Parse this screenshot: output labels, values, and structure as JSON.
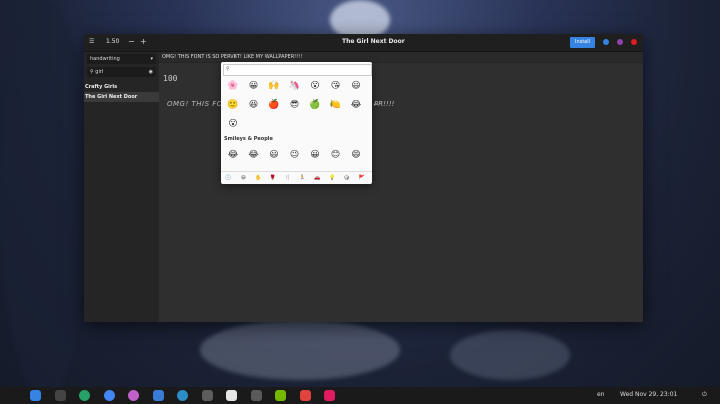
{
  "toolbar": {
    "menu_icon": "hamburger-icon",
    "font_size": "1.50",
    "decrease_label": "−",
    "increase_label": "+",
    "window_title": "The Girl Next Door",
    "install_label": "Install",
    "install_color": "#3584e4",
    "dot_colors": [
      "#3584e4",
      "#9141ac",
      "#e01b24"
    ]
  },
  "sidebar": {
    "category_value": "handwriting",
    "search_value": "girl",
    "items": [
      {
        "label": "Crafty Girls"
      },
      {
        "label": "The Girl Next Door"
      }
    ]
  },
  "preview": {
    "input_value": "OMG! THIS FONT IS SO PERVE̶T! LIKE MY WALLPAPER!!!!",
    "size_label": "100",
    "rendered_text": "OMG! THIS FON",
    "rendered_tail": "P̶R!!!!"
  },
  "emoji_picker": {
    "recent": [
      "🌸",
      "😀",
      "🙌",
      "🦄",
      "😮",
      "😘",
      "😃",
      "🙂",
      "😆",
      "🍎",
      "😎",
      "🍏",
      "🍋",
      "😂",
      "😮"
    ],
    "section_title": "Smileys & People",
    "smileys": [
      "😂",
      "😂",
      "😃",
      "😉",
      "😀",
      "😊",
      "😄"
    ],
    "categories": [
      "🕘",
      "😀",
      "✋",
      "🌹",
      "🍴",
      "🏃",
      "🚗",
      "💡",
      "🎲",
      "🚩"
    ]
  },
  "taskbar": {
    "apps": [
      "files",
      "terminal",
      "settings",
      "chrome",
      "media",
      "software",
      "browser",
      "chat",
      "editor",
      "folder",
      "nvidia",
      "photos",
      "weather"
    ],
    "language": "en",
    "clock": "Wed Nov 29, 23:01"
  }
}
